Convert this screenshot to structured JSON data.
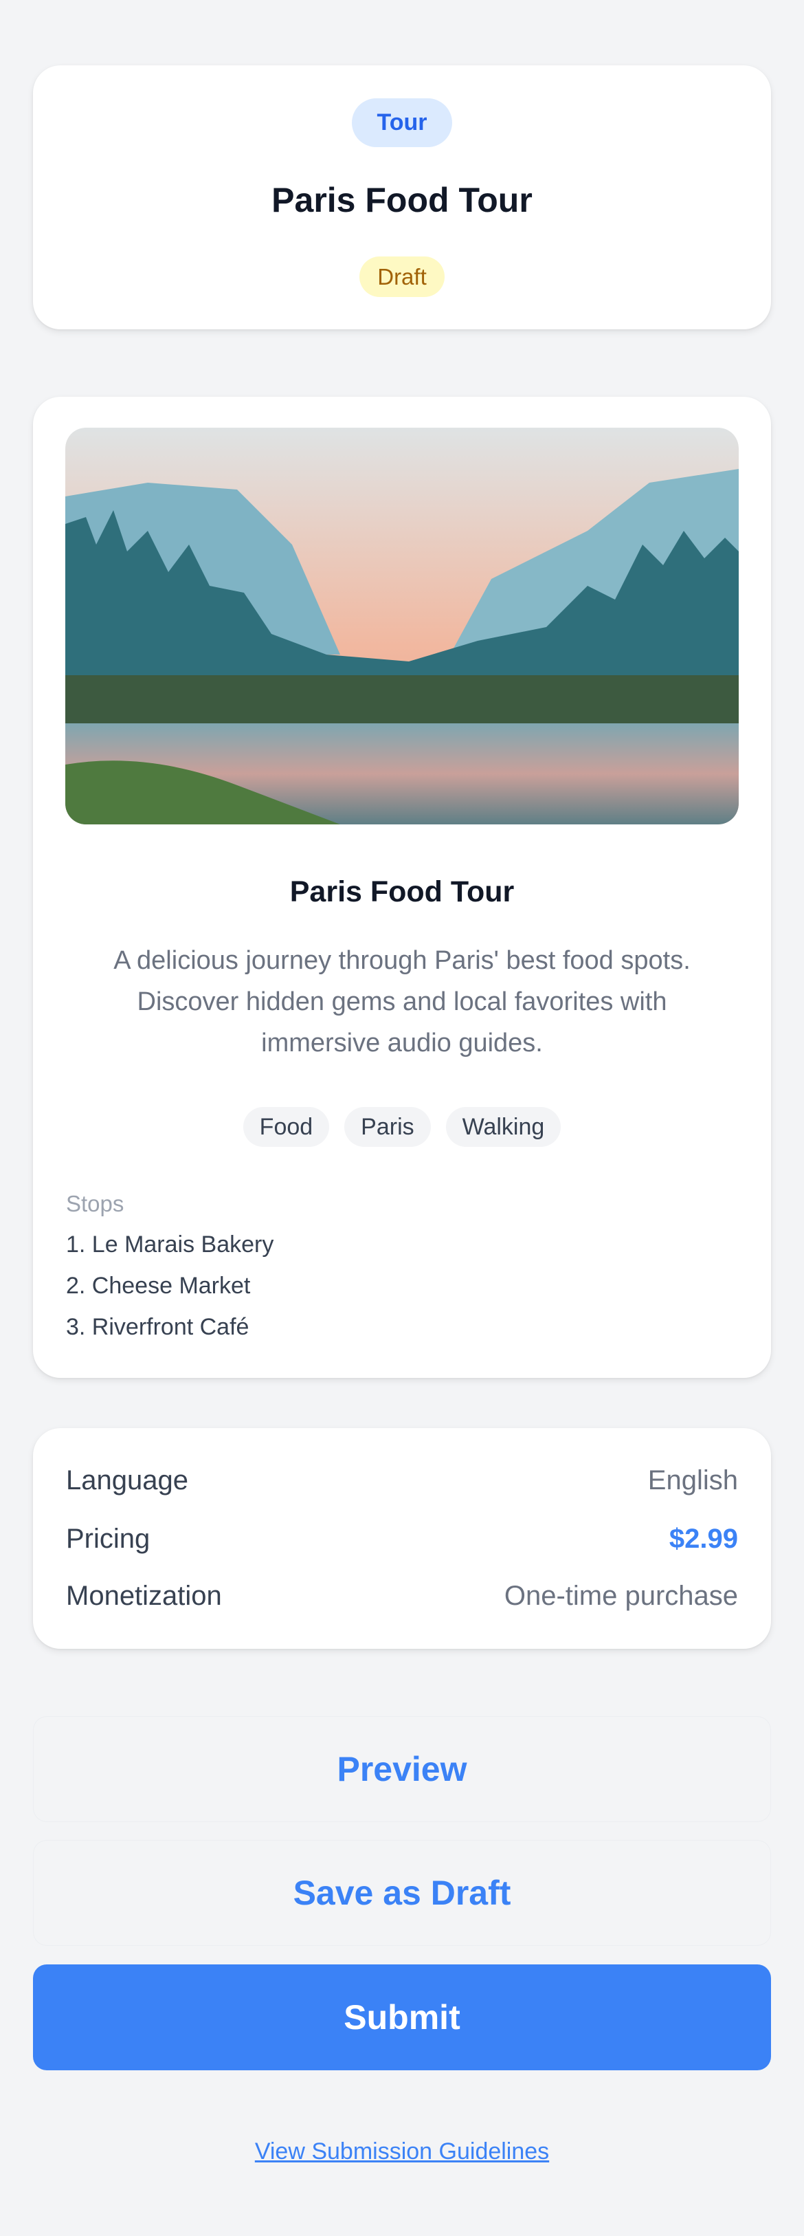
{
  "header": {
    "type_badge": "Tour",
    "title": "Paris Food Tour",
    "status_badge": "Draft"
  },
  "details": {
    "title": "Paris Food Tour",
    "description": "A delicious journey through Paris' best food spots. Discover hidden gems and local favorites with immersive audio guides.",
    "tags": [
      "Food",
      "Paris",
      "Walking"
    ],
    "stops_label": "Stops",
    "stops": [
      "1. Le Marais Bakery",
      "2. Cheese Market",
      "3. Riverfront Café"
    ]
  },
  "info": {
    "rows": [
      {
        "label": "Language",
        "value": "English"
      },
      {
        "label": "Pricing",
        "value": "$2.99"
      },
      {
        "label": "Monetization",
        "value": "One-time purchase"
      }
    ]
  },
  "actions": {
    "preview": "Preview",
    "save_draft": "Save as Draft",
    "submit": "Submit",
    "guidelines_link": "View Submission Guidelines"
  },
  "colors": {
    "accent": "#3b82f6",
    "draft_bg": "#fef9c3",
    "draft_text": "#a16207",
    "tour_bg": "#dbeafe",
    "tour_text": "#2563eb"
  }
}
